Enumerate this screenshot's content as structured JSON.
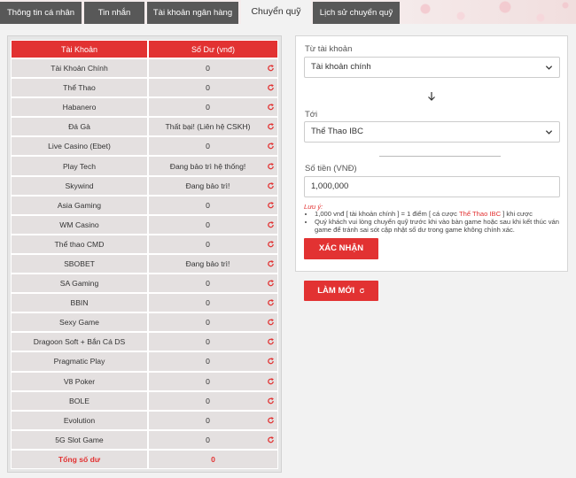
{
  "tabs": [
    {
      "label": "Thông tin cá nhân"
    },
    {
      "label": "Tin nhắn"
    },
    {
      "label": "Tài khoản ngân hàng"
    },
    {
      "label": "Chuyển quỹ"
    },
    {
      "label": "Lịch sử chuyển quỹ"
    }
  ],
  "table": {
    "header_account": "Tài Khoản",
    "header_balance": "Số Dư (vnđ)",
    "rows": [
      {
        "account": "Tài Khoản Chính",
        "balance": "0"
      },
      {
        "account": "Thể Thao",
        "balance": "0"
      },
      {
        "account": "Habanero",
        "balance": "0"
      },
      {
        "account": "Đá Gà",
        "balance": "Thất bại! (Liên hệ CSKH)"
      },
      {
        "account": "Live Casino (Ebet)",
        "balance": "0"
      },
      {
        "account": "Play Tech",
        "balance": "Đang bảo trì hệ thống!"
      },
      {
        "account": "Skywind",
        "balance": "Đang bảo trì!"
      },
      {
        "account": "Asia Gaming",
        "balance": "0"
      },
      {
        "account": "WM Casino",
        "balance": "0"
      },
      {
        "account": "Thể thao CMD",
        "balance": "0"
      },
      {
        "account": "SBOBET",
        "balance": "Đang bảo trì!"
      },
      {
        "account": "SA Gaming",
        "balance": "0"
      },
      {
        "account": "BBIN",
        "balance": "0"
      },
      {
        "account": "Sexy Game",
        "balance": "0"
      },
      {
        "account": "Dragoon Soft + Bắn Cá DS",
        "balance": "0"
      },
      {
        "account": "Pragmatic Play",
        "balance": "0"
      },
      {
        "account": "V8 Poker",
        "balance": "0"
      },
      {
        "account": "BOLE",
        "balance": "0"
      },
      {
        "account": "Evolution",
        "balance": "0"
      },
      {
        "account": "5G Slot Game",
        "balance": "0"
      }
    ],
    "total_label": "Tổng số dư",
    "total_value": "0"
  },
  "transfer": {
    "from_label": "Từ tài khoản",
    "from_value": "Tài khoản chính",
    "to_label": "Tới",
    "to_value": "Thể Thao IBC",
    "amount_label": "Số tiền (VNĐ)",
    "amount_value": "1,000,000",
    "note_title": "Lưu ý:",
    "note_1_pre": "1,000 vnđ [ tài khoản chính ] = 1 điểm [ cá cược ",
    "note_1_hl": "Thể Thao IBC",
    "note_1_post": " ] khi cược",
    "note_2": "Quý khách vui lòng chuyển quỹ trước khi vào bàn game hoặc sau khi kết thúc ván game để tránh sai sót cập nhật số dư trong game không chính xác.",
    "confirm_label": "XÁC NHẬN",
    "reset_label": "LÀM MỚI"
  },
  "colors": {
    "accent": "#e23232",
    "tab_bg": "#585858"
  },
  "icons": {
    "refresh": "refresh-icon",
    "chevron": "chevron-down-icon",
    "arrow": "arrow-down-icon"
  }
}
